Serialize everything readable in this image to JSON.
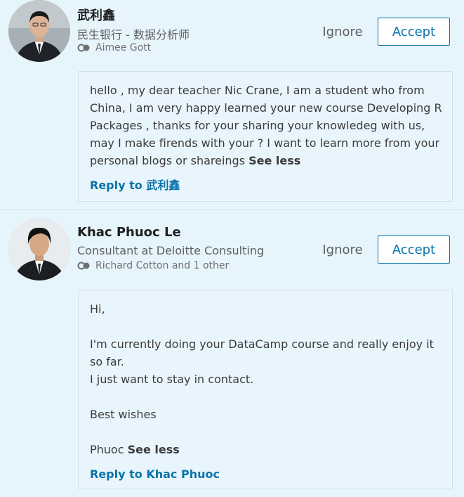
{
  "invitations": [
    {
      "name": "武利鑫",
      "headline": "民生银行 - 数据分析师",
      "shared_connections": "Aimee Gott",
      "ignore_label": "Ignore",
      "accept_label": "Accept",
      "message": "hello , my dear teacher Nic Crane, I am a student who from China, I am very happy learned your new course Developing R Packages , thanks for your sharing your knowledeg with us, may I make firends with your ? I want to learn more from your personal blogs or shareings",
      "see_less_label": "See less",
      "reply_label": "Reply to 武利鑫"
    },
    {
      "name": "Khac Phuoc Le",
      "headline": "Consultant at Deloitte Consulting",
      "shared_connections": "Richard Cotton and 1 other",
      "ignore_label": "Ignore",
      "accept_label": "Accept",
      "message": "Hi,\n\nI'm currently doing your DataCamp course and really enjoy it so far.\nI just want to stay in contact.\n\nBest wishes\n\nPhuoc",
      "see_less_label": "See less",
      "reply_label": "Reply to Khac Phuoc"
    }
  ],
  "colors": {
    "background": "#e6f4fc",
    "accent": "#0a73a8",
    "text": "#3b3b3b"
  },
  "icons": {
    "avatar_1": "profile-photo",
    "avatar_2": "profile-photo",
    "shared": "shared-connections-icon"
  }
}
